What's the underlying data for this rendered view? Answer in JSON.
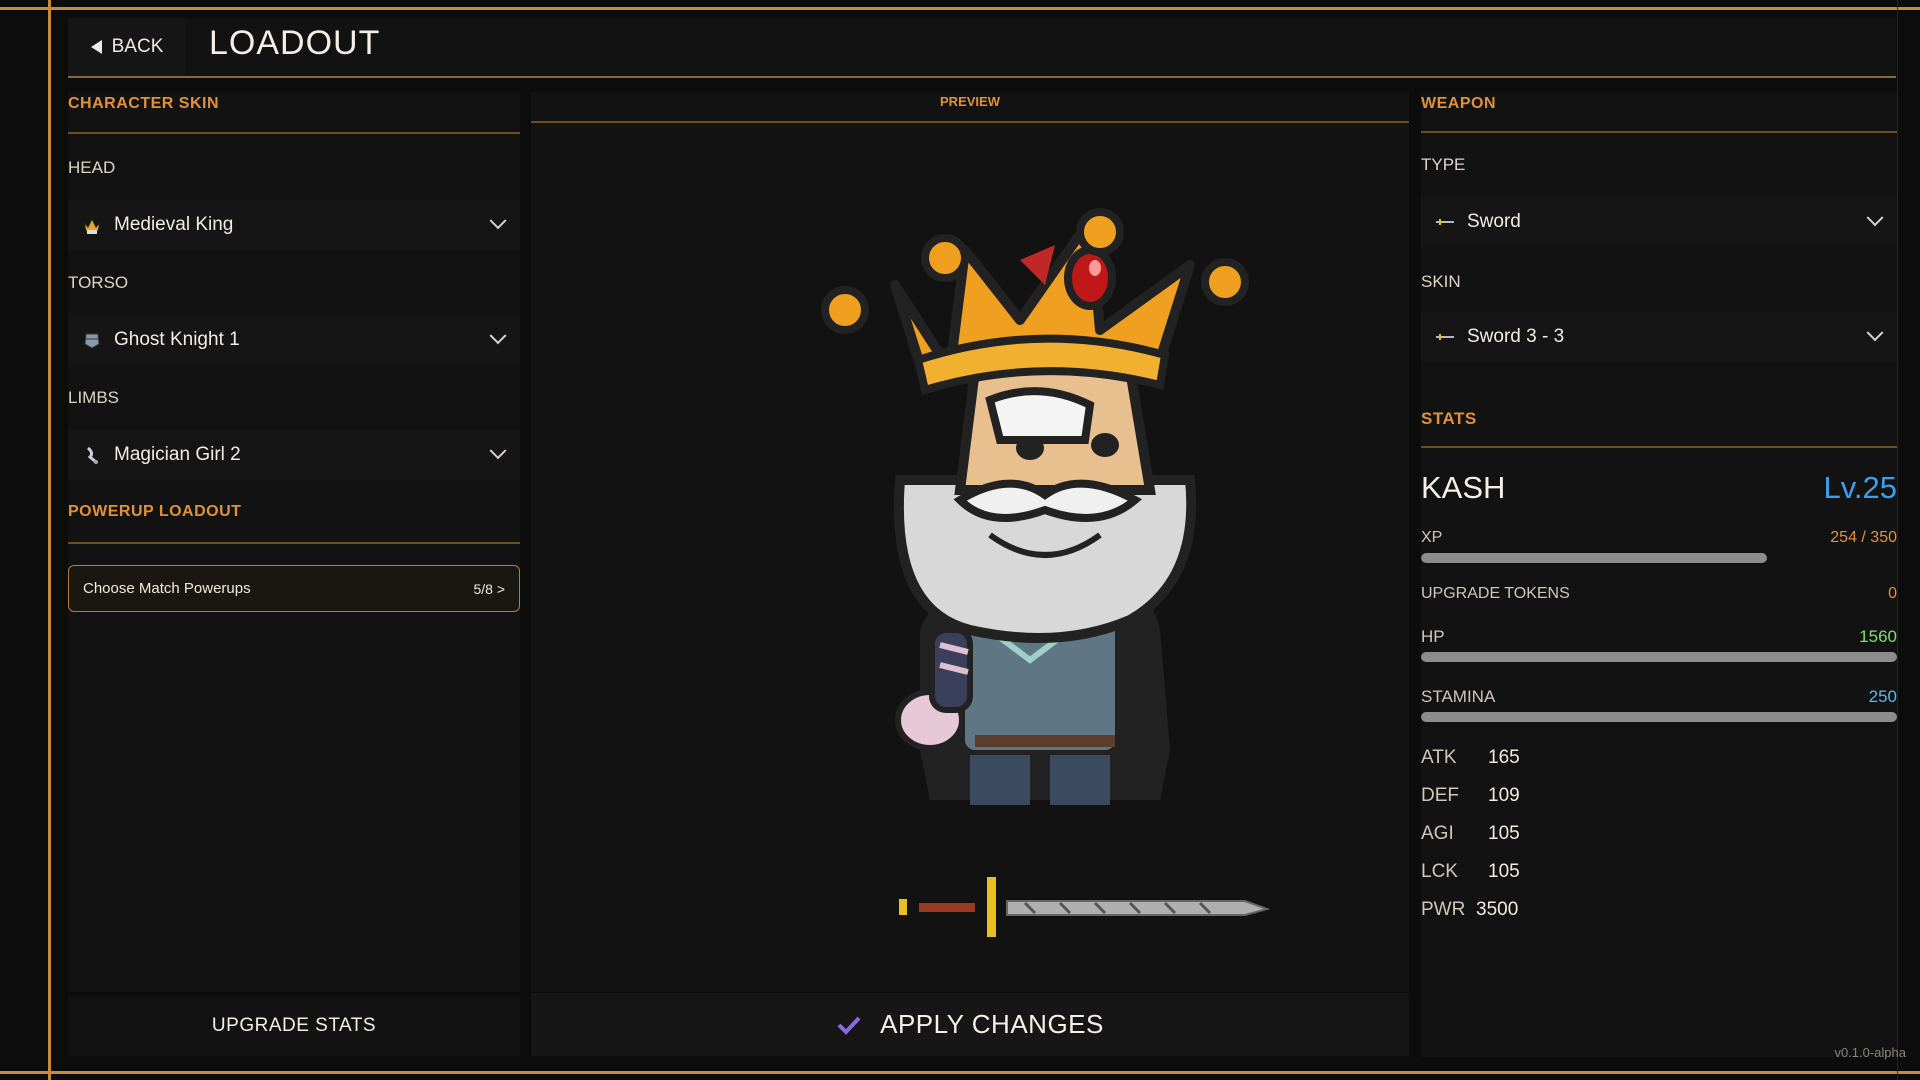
{
  "header": {
    "back_label": "BACK",
    "title": "LOADOUT"
  },
  "left": {
    "character_skin_title": "CHARACTER SKIN",
    "head_label": "HEAD",
    "head_value": "Medieval King",
    "torso_label": "TORSO",
    "torso_value": "Ghost Knight 1",
    "limbs_label": "LIMBS",
    "limbs_value": "Magician Girl 2",
    "powerup_title": "POWERUP LOADOUT",
    "powerup_button": "Choose Match Powerups",
    "powerup_count": "5/8 >",
    "upgrade_button": "UPGRADE STATS"
  },
  "preview": {
    "title": "PREVIEW",
    "apply_button": "APPLY CHANGES"
  },
  "right": {
    "weapon_title": "WEAPON",
    "type_label": "TYPE",
    "type_value": "Sword",
    "skin_label": "SKIN",
    "skin_value": "Sword 3 - 3",
    "stats_title": "STATS",
    "name": "KASH",
    "level": "Lv.25",
    "xp_label": "XP",
    "xp_value": "254 / 350",
    "xp_fraction": 0.726,
    "tokens_label": "UPGRADE TOKENS",
    "tokens_value": "0",
    "hp_label": "HP",
    "hp_value": "1560",
    "hp_fraction": 1.0,
    "stamina_label": "STAMINA",
    "stamina_value": "250",
    "stamina_fraction": 1.0,
    "stats": [
      {
        "name": "ATK",
        "value": "165"
      },
      {
        "name": "DEF",
        "value": "109"
      },
      {
        "name": "AGI",
        "value": "105"
      },
      {
        "name": "LCK",
        "value": "105"
      },
      {
        "name": "PWR",
        "value": "3500"
      }
    ]
  },
  "version": "v0.1.0-alpha",
  "colors": {
    "accent": "#e0913a",
    "level": "#3aa0f0",
    "hp": "#7ee06a",
    "stamina": "#5ab8f0",
    "xp": "#e0913a",
    "check": "#8a6ae0"
  }
}
